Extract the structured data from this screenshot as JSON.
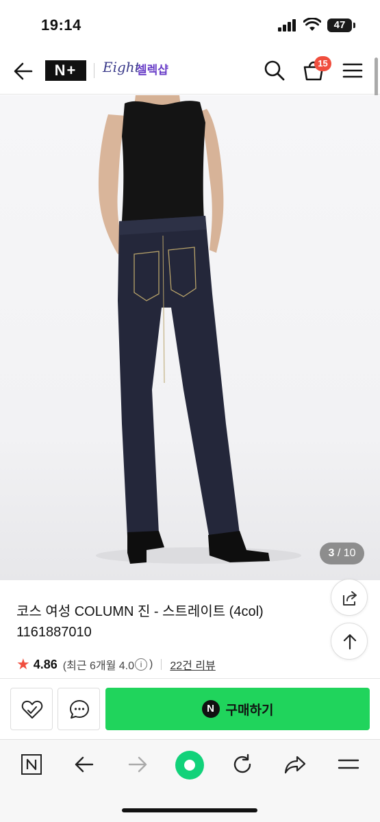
{
  "status_bar": {
    "time": "19:14",
    "battery": "47"
  },
  "header": {
    "logo_nplus": "N+",
    "brand_script": "Eight",
    "brand_korean": "셀렉샵",
    "cart_count": "15"
  },
  "gallery": {
    "current": "3",
    "separator": " / ",
    "total": "10"
  },
  "product": {
    "title": "코스 여성 COLUMN 진 - 스트레이트 (4col)",
    "id": "1161887010",
    "rating_star": "★",
    "rating": "4.86",
    "recent_rating": "(최근 6개월 4.0",
    "info_glyph": "i",
    "recent_rating_close": ")",
    "review_count": "22건 리뷰"
  },
  "actions": {
    "buy_logo": "N",
    "buy_label": "구매하기"
  },
  "browser_bar": {
    "n_tab": "N"
  },
  "colors": {
    "buy_green": "#20d45c",
    "badge_red": "#f04e3e",
    "star_red": "#f04e3e",
    "browser_green": "#12d27a",
    "brand_purple": "#6a3fc8"
  },
  "icons": {
    "header": [
      "back-arrow-icon",
      "search-icon",
      "cart-icon",
      "hamburger-menu-icon"
    ],
    "floating": [
      "share-icon",
      "arrow-up-icon"
    ],
    "action": [
      "heart-icon",
      "chat-bubble-icon"
    ],
    "browser": [
      "n-tab-icon",
      "browser-back-icon",
      "browser-forward-icon",
      "home-icon",
      "reload-icon",
      "browser-share-icon",
      "browser-menu-icon"
    ]
  }
}
